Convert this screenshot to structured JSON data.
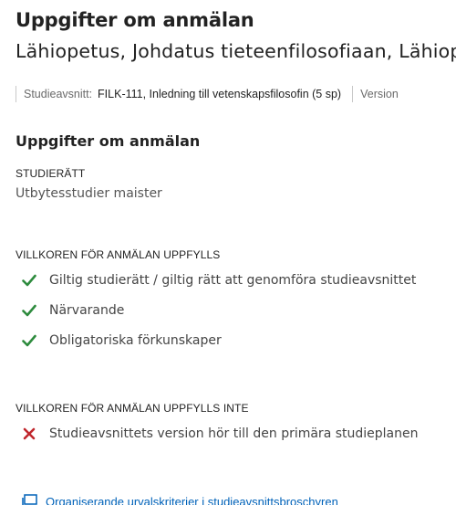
{
  "header": {
    "title": "Uppgifter om anmälan",
    "subtitle": "Lähiopetus, Johdatus tieteenfilosofiaan, Lähiopetus"
  },
  "info": {
    "label": "Studieavsnitt:",
    "value": "FILK-111, Inledning till vetenskapsfilosofin (5 sp)",
    "version": "Version"
  },
  "section": {
    "title": "Uppgifter om anmälan",
    "study_right_label": "STUDIERÄTT",
    "study_right_value": "Utbytesstudier maister"
  },
  "conditions_met": {
    "heading": "VILLKOREN FÖR ANMÄLAN UPPFYLLS",
    "items": [
      "Giltig studierätt / giltig rätt att genomföra studieavsnittet",
      "Närvarande",
      "Obligatoriska förkunskaper"
    ]
  },
  "conditions_unmet": {
    "heading": "VILLKOREN FÖR ANMÄLAN UPPFYLLS INTE",
    "items": [
      "Studieavsnittets version hör till den primära studieplanen"
    ]
  },
  "link": {
    "text": "Organiserande urvalskriterier i studieavsnittsbroschyren",
    "icon": "open-in-new-window-icon"
  },
  "colors": {
    "check": "#2e8b3e",
    "cross": "#c0272d",
    "link": "#0062b9"
  }
}
